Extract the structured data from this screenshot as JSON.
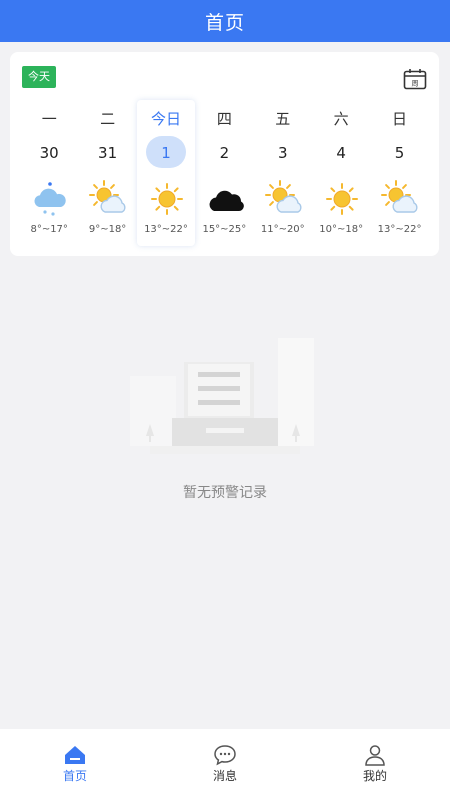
{
  "header": {
    "title": "首页"
  },
  "card": {
    "today_label": "今天",
    "calendar_icon_text": "周",
    "days": [
      {
        "weekday": "一",
        "date": "30",
        "weather": "snow",
        "temp": "8°~17°",
        "selected": false
      },
      {
        "weekday": "二",
        "date": "31",
        "weather": "partly-cloudy",
        "temp": "9°~18°",
        "selected": false
      },
      {
        "weekday": "今日",
        "date": "1",
        "weather": "sunny",
        "temp": "13°~22°",
        "selected": true
      },
      {
        "weekday": "四",
        "date": "2",
        "weather": "cloudy",
        "temp": "15°~25°",
        "selected": false
      },
      {
        "weekday": "五",
        "date": "3",
        "weather": "partly-cloudy",
        "temp": "11°~20°",
        "selected": false
      },
      {
        "weekday": "六",
        "date": "4",
        "weather": "sunny",
        "temp": "10°~18°",
        "selected": false
      },
      {
        "weekday": "日",
        "date": "5",
        "weather": "partly-cloudy",
        "temp": "13°~22°",
        "selected": false
      }
    ]
  },
  "empty": {
    "text": "暂无预警记录"
  },
  "tabbar": {
    "home": "首页",
    "messages": "消息",
    "mine": "我的"
  },
  "colors": {
    "accent": "#3a78f2",
    "badge": "#2cb35a",
    "background": "#f2f2f4"
  }
}
